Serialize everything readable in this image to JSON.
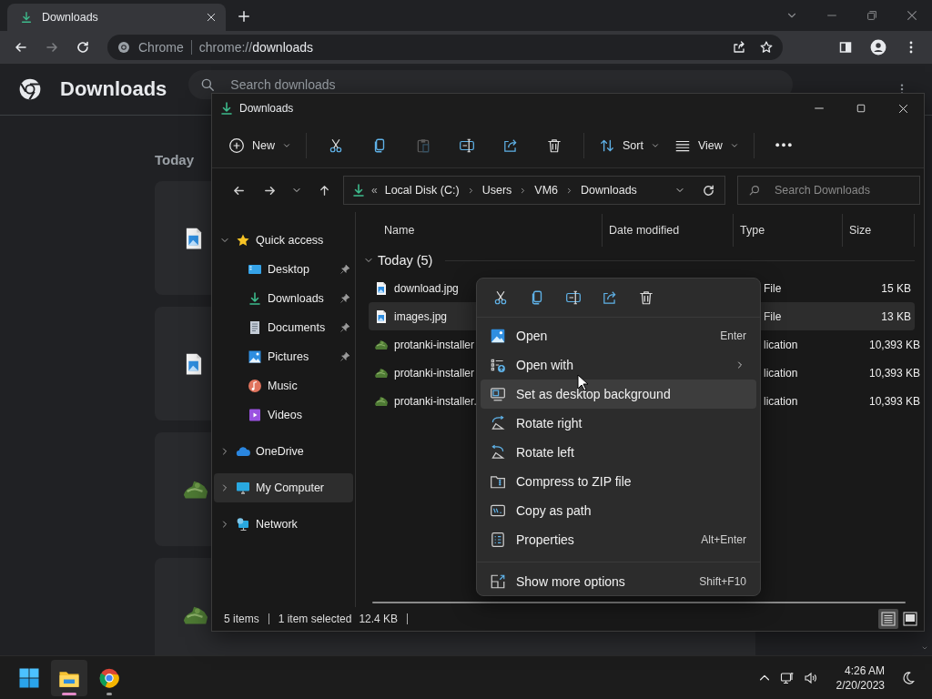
{
  "chrome": {
    "tab": {
      "title": "Downloads"
    },
    "omnibox": {
      "site": "Chrome",
      "scheme": "chrome://",
      "host": "downloads"
    },
    "page": {
      "title": "Downloads",
      "search": {
        "placeholder": "Search downloads"
      },
      "section": "Today",
      "cards": [
        {
          "kind": "image"
        },
        {
          "kind": "image"
        },
        {
          "kind": "app"
        },
        {
          "kind": "app"
        }
      ]
    }
  },
  "explorer": {
    "title": "Downloads",
    "toolbar": [
      {
        "kind": "new",
        "label": "New",
        "disabled": false
      },
      {
        "kind": "cut",
        "disabled": false
      },
      {
        "kind": "copy",
        "disabled": false
      },
      {
        "kind": "paste",
        "disabled": true
      },
      {
        "kind": "rename",
        "disabled": false
      },
      {
        "kind": "share",
        "disabled": false
      },
      {
        "kind": "delete",
        "disabled": false
      },
      {
        "kind": "sort",
        "label": "Sort",
        "disabled": false
      },
      {
        "kind": "view",
        "label": "View",
        "disabled": false
      },
      {
        "kind": "more",
        "disabled": false
      }
    ],
    "overflow": "«",
    "path": [
      "Local Disk (C:)",
      "Users",
      "VM6",
      "Downloads"
    ],
    "search": {
      "placeholder": "Search Downloads"
    },
    "nav": [
      {
        "label": "Quick access",
        "kind": "star",
        "expanded": true,
        "selected": false,
        "children": [
          {
            "label": "Desktop",
            "kind": "desktop",
            "pinned": true,
            "selected": false
          },
          {
            "label": "Downloads",
            "kind": "downloads",
            "pinned": true,
            "selected": false
          },
          {
            "label": "Documents",
            "kind": "documents",
            "pinned": true,
            "selected": false
          },
          {
            "label": "Pictures",
            "kind": "pictures",
            "pinned": true,
            "selected": false
          },
          {
            "label": "Music",
            "kind": "music",
            "pinned": false,
            "selected": false
          },
          {
            "label": "Videos",
            "kind": "videos",
            "pinned": false,
            "selected": false
          }
        ]
      },
      {
        "label": "OneDrive",
        "kind": "cloud",
        "expanded": false,
        "selected": false
      },
      {
        "label": "My Computer",
        "kind": "computer",
        "expanded": false,
        "selected": true
      },
      {
        "label": "Network",
        "kind": "network",
        "expanded": false,
        "selected": false
      }
    ],
    "columns": [
      "Name",
      "Date modified",
      "Type",
      "Size"
    ],
    "group": {
      "label": "Today (5)",
      "expanded": true
    },
    "files": [
      {
        "name": "download.jpg",
        "kind": "image",
        "type": "File",
        "size": "15 KB",
        "selected": false
      },
      {
        "name": "images.jpg",
        "kind": "image",
        "type": "File",
        "size": "13 KB",
        "selected": true
      },
      {
        "name": "protanki-installer",
        "kind": "app",
        "type": "lication",
        "size": "10,393 KB",
        "selected": false
      },
      {
        "name": "protanki-installer",
        "kind": "app",
        "type": "lication",
        "size": "10,393 KB",
        "selected": false
      },
      {
        "name": "protanki-installer.",
        "kind": "app",
        "type": "lication",
        "size": "10,393 KB",
        "selected": false
      }
    ],
    "status": {
      "count": "5 items",
      "selection": "1 item selected",
      "size": "12.4 KB"
    },
    "views": [
      {
        "kind": "details",
        "selected": true
      },
      {
        "kind": "tiles",
        "selected": false
      }
    ]
  },
  "context_menu": {
    "actions": [
      {
        "kind": "cut"
      },
      {
        "kind": "copy"
      },
      {
        "kind": "rename"
      },
      {
        "kind": "share"
      },
      {
        "kind": "delete"
      }
    ],
    "items": [
      {
        "label": "Open",
        "kind": "open",
        "shortcut": "Enter",
        "submenu": false,
        "selected": false
      },
      {
        "label": "Open with",
        "kind": "openwith",
        "submenu": true,
        "selected": false
      },
      {
        "label": "Set as desktop background",
        "kind": "wallpaper",
        "submenu": false,
        "selected": true
      },
      {
        "label": "Rotate right",
        "kind": "rotright",
        "submenu": false,
        "selected": false
      },
      {
        "label": "Rotate left",
        "kind": "rotleft",
        "submenu": false,
        "selected": false
      },
      {
        "label": "Compress to ZIP file",
        "kind": "zip",
        "submenu": false,
        "selected": false
      },
      {
        "label": "Copy as path",
        "kind": "path",
        "submenu": false,
        "selected": false
      },
      {
        "label": "Properties",
        "kind": "properties",
        "shortcut": "Alt+Enter",
        "submenu": false,
        "selected": false
      }
    ],
    "footer": {
      "label": "Show more options",
      "kind": "moreoptions",
      "shortcut": "Shift+F10"
    }
  },
  "taskbar": {
    "apps": [
      {
        "kind": "explorer",
        "active": true
      },
      {
        "kind": "chrome",
        "active": false
      }
    ],
    "time": "4:26 AM",
    "date": "2/20/2023"
  }
}
